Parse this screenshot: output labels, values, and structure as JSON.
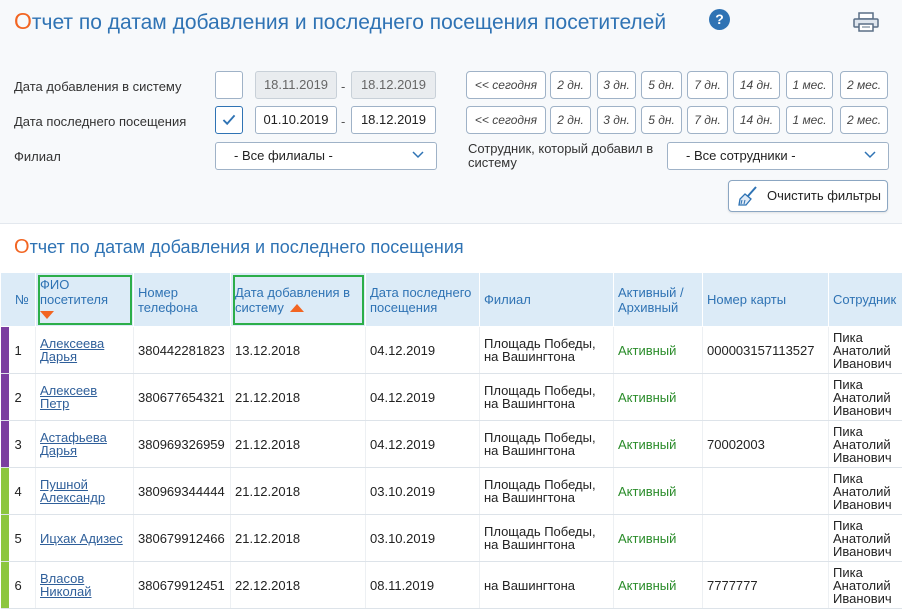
{
  "header": {
    "title_first": "О",
    "title_rest": "тчет по датам добавления и последнего посещения посетителей",
    "help": "?"
  },
  "filters": {
    "added_label": "Дата добавления в систему",
    "added_from": "18.11.2019",
    "added_to": "18.12.2019",
    "visit_label": "Дата последнего посещения",
    "visit_from": "01.10.2019",
    "visit_to": "18.12.2019",
    "dash": "-",
    "branch_label": "Филиал",
    "branch_value": "- Все филиалы -",
    "employee_label": "Сотрудник, который добавил в систему",
    "employee_value": "- Все сотрудники -",
    "clear_label": "Очистить фильтры",
    "quick": [
      "<< сегодня",
      "2 дн.",
      "3 дн.",
      "5 дн.",
      "7 дн.",
      "14 дн.",
      "1 мес.",
      "2 мес."
    ]
  },
  "section": {
    "title_first": "О",
    "title_rest": "тчет по датам добавления и последнего посещения"
  },
  "table": {
    "headers": {
      "num": "№",
      "name": "ФИО посетителя",
      "phone": "Номер телефона",
      "added": "Дата добавления в систему",
      "visit": "Дата последнего посещения",
      "branch": "Филиал",
      "status": "Активный / Архивный",
      "card": "Номер карты",
      "employee": "Сотрудник"
    },
    "rows": [
      {
        "num": "1",
        "name": "Алексеева Дарья",
        "phone": "380442281823",
        "added": "13.12.2018",
        "visit": "04.12.2019",
        "branch": "Площадь Победы, на Вашингтона",
        "status": "Активный",
        "card": "000003157113527",
        "employee": "Пика Анатолий Иванович",
        "color": "#7b3fa0"
      },
      {
        "num": "2",
        "name": "Алексеев Петр",
        "phone": "380677654321",
        "added": "21.12.2018",
        "visit": "04.12.2019",
        "branch": "Площадь Победы, на Вашингтона",
        "status": "Активный",
        "card": "",
        "employee": "Пика Анатолий Иванович",
        "color": "#7b3fa0"
      },
      {
        "num": "3",
        "name": "Астафьева Дарья",
        "phone": "380969326959",
        "added": "21.12.2018",
        "visit": "04.12.2019",
        "branch": "Площадь Победы, на Вашингтона",
        "status": "Активный",
        "card": "70002003",
        "employee": "Пика Анатолий Иванович",
        "color": "#7b3fa0"
      },
      {
        "num": "4",
        "name": "Пушной Александр",
        "phone": "380969344444",
        "added": "21.12.2018",
        "visit": "03.10.2019",
        "branch": "Площадь Победы, на Вашингтона",
        "status": "Активный",
        "card": "",
        "employee": "Пика Анатолий Иванович",
        "color": "#8cc63f"
      },
      {
        "num": "5",
        "name": "Ицхак Адизес",
        "phone": "380679912466",
        "added": "21.12.2018",
        "visit": "03.10.2019",
        "branch": "Площадь Победы, на Вашингтона",
        "status": "Активный",
        "card": "",
        "employee": "Пика Анатолий Иванович",
        "color": "#8cc63f"
      },
      {
        "num": "6",
        "name": "Власов Николай",
        "phone": "380679912451",
        "added": "22.12.2018",
        "visit": "08.11.2019",
        "branch": "на Вашингтона",
        "status": "Активный",
        "card": "7777777",
        "employee": "Пика Анатолий Иванович",
        "color": "#8cc63f"
      }
    ]
  }
}
